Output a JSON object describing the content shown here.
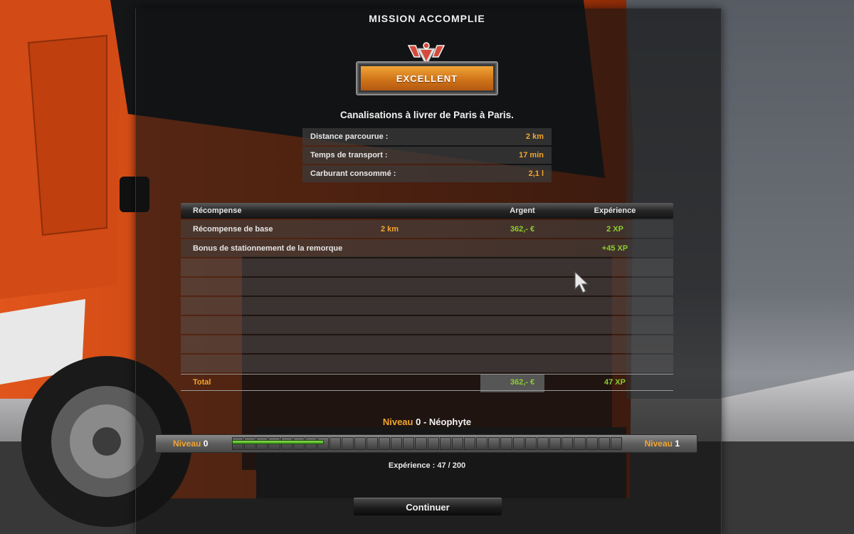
{
  "header": {
    "title": "MISSION ACCOMPLIE"
  },
  "rating": {
    "label": "EXCELLENT"
  },
  "job": {
    "description": "Canalisations à livrer de Paris à Paris."
  },
  "stats": [
    {
      "label": "Distance parcourue :",
      "value": "2 km"
    },
    {
      "label": "Temps de transport :",
      "value": "17 min"
    },
    {
      "label": "Carburant consommé :",
      "value": "2,1 l"
    }
  ],
  "rewards": {
    "headers": {
      "name": "Récompense",
      "money": "Argent",
      "xp": "Expérience"
    },
    "rows": [
      {
        "name": "Récompense de base",
        "distance": "2 km",
        "money": "362,- €",
        "xp": "2 XP"
      },
      {
        "name": "Bonus de stationnement de la remorque",
        "distance": "",
        "money": "",
        "xp": "+45 XP"
      }
    ],
    "empty_rows": 6,
    "total": {
      "label": "Total",
      "money": "362,- €",
      "xp": "47 XP"
    }
  },
  "level": {
    "prefix": "Niveau",
    "current": "0",
    "separator": " - ",
    "rank": "Néophyte",
    "bar_left_label": "Niveau",
    "bar_left_value": "0",
    "bar_right_label": "Niveau",
    "bar_right_value": "1",
    "segments": 32,
    "progress_fraction": 0.235,
    "xp_text": "Expérience : 47 / 200"
  },
  "actions": {
    "continue_label": "Continuer"
  },
  "colors": {
    "accent": "#f3a62f",
    "positive": "#8ccf2e",
    "truck": "#c8400f",
    "badge": "#d0741a"
  }
}
